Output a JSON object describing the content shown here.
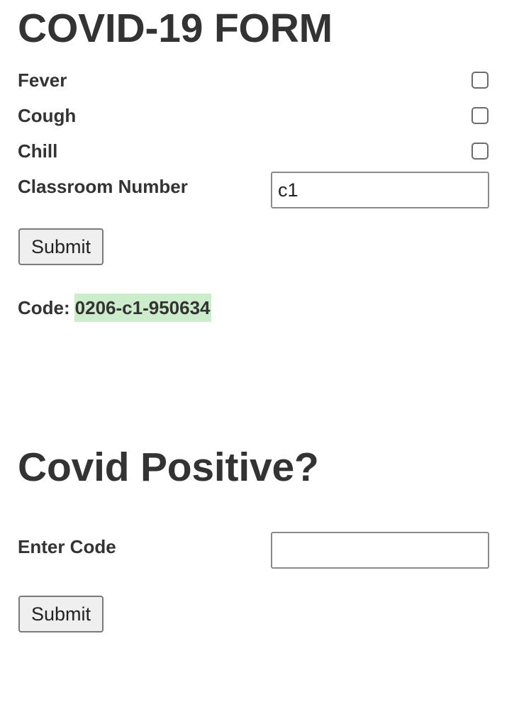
{
  "symptom_form": {
    "title": "COVID-19 FORM",
    "symptoms": [
      {
        "label": "Fever",
        "checked": false
      },
      {
        "label": "Cough",
        "checked": false
      },
      {
        "label": "Chill",
        "checked": false
      }
    ],
    "classroom_label": "Classroom Number",
    "classroom_value": "c1",
    "submit_label": "Submit",
    "code_label": "Code:",
    "code_value": "0206-c1-950634"
  },
  "positive_form": {
    "title": "Covid Positive?",
    "code_label": "Enter Code",
    "code_value": "",
    "submit_label": "Submit"
  },
  "colors": {
    "text": "#333333",
    "code_highlight": "#cdeccb",
    "button_bg": "#efefef"
  }
}
